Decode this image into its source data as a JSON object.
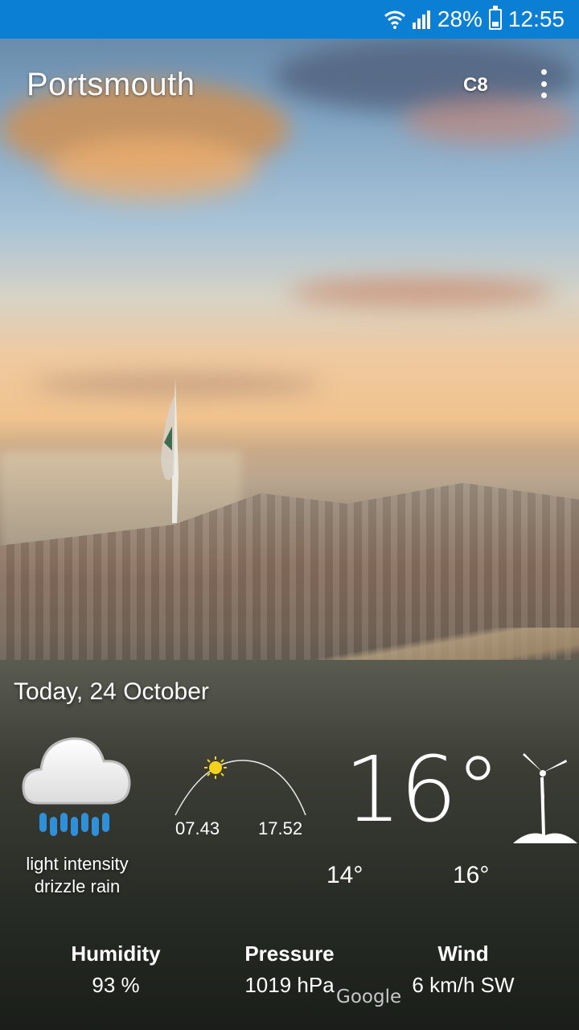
{
  "status_bar": {
    "battery": "28%",
    "time": "12:55"
  },
  "header": {
    "city": "Portsmouth",
    "unit_toggle": "C8",
    "menu_icon": "more-vert-icon"
  },
  "today": {
    "date": "Today, 24 October",
    "condition_line1": "light intensity",
    "condition_line2": "drizzle rain",
    "condition_icon": "cloud-rain-icon",
    "sunrise": "07.43",
    "sunset": "17.52",
    "temperature": "16°",
    "temp_low": "14°",
    "temp_high": "16°",
    "wind_icon": "wind-turbine-icon"
  },
  "stats": {
    "humidity_label": "Humidity",
    "humidity_value": "93 %",
    "pressure_label": "Pressure",
    "pressure_value": "1019 hPa",
    "wind_label": "Wind",
    "wind_value": "6 km/h SW"
  },
  "branding": {
    "logo": "Google"
  },
  "colors": {
    "status_bar": "#0b7fd4",
    "sun": "#f2d21b",
    "rain": "#2f8fd8"
  }
}
